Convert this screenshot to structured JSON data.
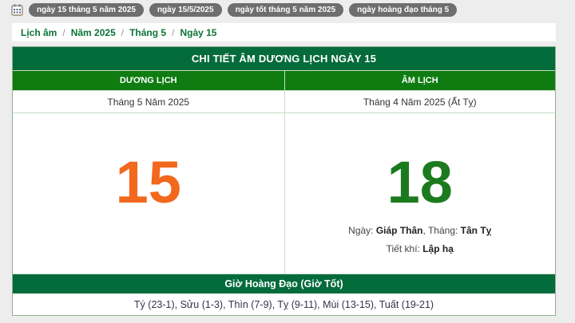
{
  "tagbar": {
    "tags": [
      "ngày 15 tháng 5 năm 2025",
      "ngày 15/5/2025",
      "ngày tốt tháng 5 năm 2025",
      "ngày hoàng đạo tháng 5"
    ]
  },
  "breadcrumb": {
    "items": [
      "Lịch âm",
      "Năm 2025",
      "Tháng 5",
      "Ngày 15"
    ],
    "separator": "/"
  },
  "detail": {
    "title": "CHI TIẾT ÂM DƯƠNG LỊCH NGÀY 15",
    "solar": {
      "header": "DƯƠNG LỊCH",
      "month": "Tháng 5 Năm 2025",
      "day": "15"
    },
    "lunar": {
      "header": "ÂM LỊCH",
      "month": "Tháng 4 Năm 2025 (Ất Tỵ)",
      "day": "18",
      "ngay_label": "Ngày: ",
      "ngay_value": "Giáp Thân",
      "sep": ", ",
      "thang_label": "Tháng: ",
      "thang_value": "Tân Tỵ",
      "tietkhi_label": "Tiết khí: ",
      "tietkhi_value": "Lập hạ"
    },
    "hoangdao": {
      "title": "Giờ Hoàng Đạo (Giờ Tốt)",
      "hours": "Tý (23-1), Sửu (1-3), Thìn (7-9), Tỵ (9-11), Mùi (13-15), Tuất (19-21)"
    }
  },
  "colors": {
    "title_bar_green": "#046b3b",
    "header_row_green": "#0e7c10",
    "solar_day_orange": "#f2681c",
    "lunar_day_green": "#1c7a1e",
    "breadcrumb_link_green": "#0d7336",
    "tag_pill_gray": "#6e6e6e",
    "page_background": "#ededed"
  }
}
